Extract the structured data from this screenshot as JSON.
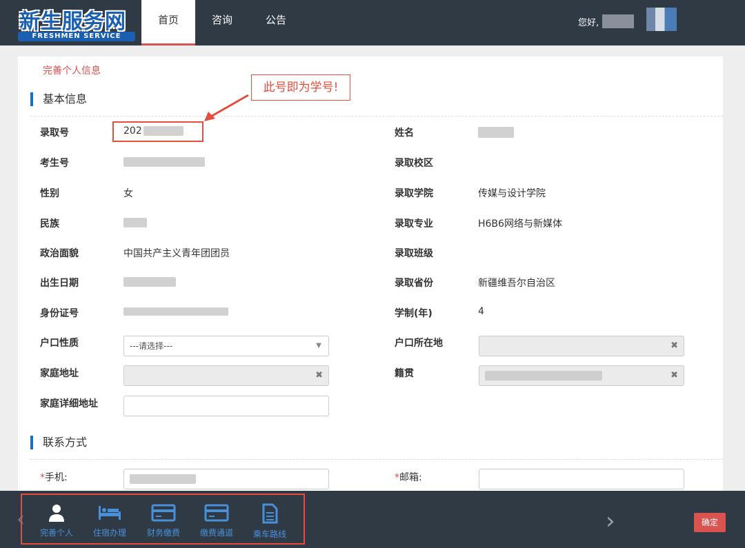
{
  "logo": {
    "main": "新生服务网",
    "sub": "FRESHMEN SERVICE"
  },
  "nav": {
    "home": "首页",
    "consult": "咨询",
    "notice": "公告",
    "greeting": "您好,"
  },
  "page_title": "完善个人信息",
  "annotation": {
    "text": "此号即为学号!"
  },
  "sections": {
    "basic": "基本信息",
    "contact": "联系方式"
  },
  "basic": {
    "admission_no": {
      "label": "录取号",
      "value": "202"
    },
    "exam_no": {
      "label": "考生号"
    },
    "gender": {
      "label": "性别",
      "value": "女"
    },
    "ethnicity": {
      "label": "民族"
    },
    "political": {
      "label": "政治面貌",
      "value": "中国共产主义青年团团员"
    },
    "birth": {
      "label": "出生日期"
    },
    "id_no": {
      "label": "身份证号"
    },
    "hukou_type": {
      "label": "户口性质",
      "placeholder": "---请选择---"
    },
    "home_addr": {
      "label": "家庭地址"
    },
    "home_detail": {
      "label": "家庭详细地址"
    },
    "name": {
      "label": "姓名"
    },
    "campus": {
      "label": "录取校区"
    },
    "college": {
      "label": "录取学院",
      "value": "传媒与设计学院"
    },
    "major": {
      "label": "录取专业",
      "value": "H6B6网络与新媒体"
    },
    "class": {
      "label": "录取班级"
    },
    "province": {
      "label": "录取省份",
      "value": "新疆维吾尔自治区"
    },
    "years": {
      "label": "学制(年)",
      "value": "4"
    },
    "hukou_loc": {
      "label": "户口所在地"
    },
    "native": {
      "label": "籍贯"
    }
  },
  "contact": {
    "phone": {
      "req": "*",
      "label": "手机:"
    },
    "email": {
      "req": "*",
      "label": "邮箱:"
    }
  },
  "toolbar": {
    "items": [
      {
        "label": "完善个人",
        "icon": "person-icon"
      },
      {
        "label": "住宿办理",
        "icon": "bed-icon"
      },
      {
        "label": "财务缴费",
        "icon": "card-icon"
      },
      {
        "label": "缴费通道",
        "icon": "card-icon"
      },
      {
        "label": "乘车路线",
        "icon": "document-icon"
      }
    ],
    "confirm": "确定"
  },
  "colors": {
    "nav_bg": "#2f3a45",
    "accent_red": "#d9534f",
    "accent_blue": "#1b6ec2"
  }
}
